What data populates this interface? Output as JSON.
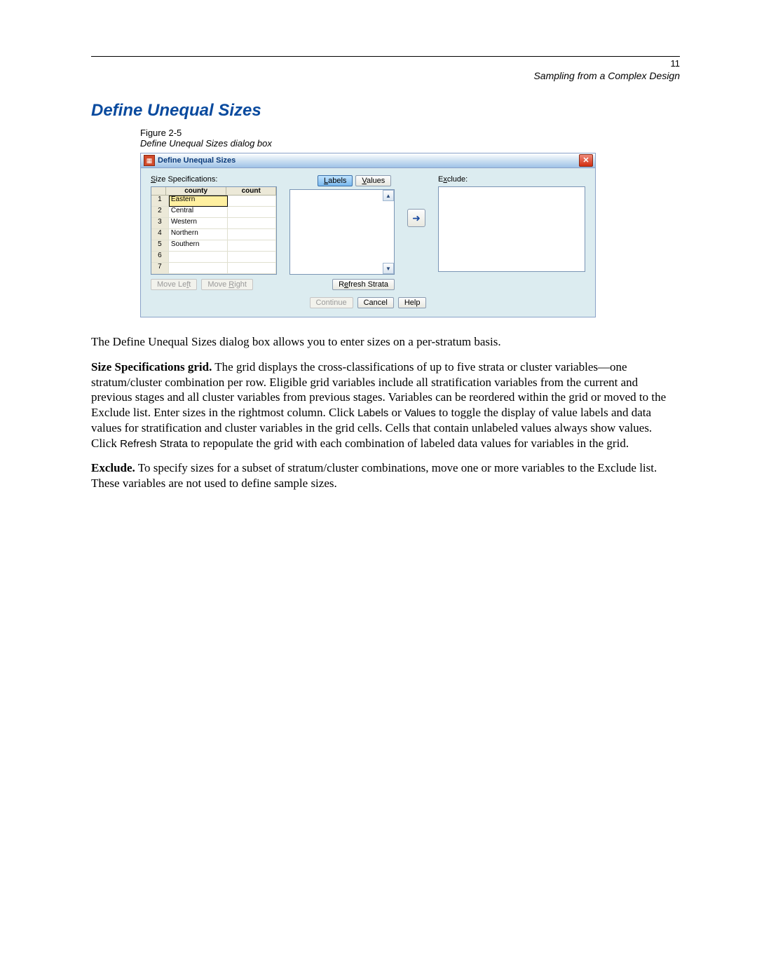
{
  "page": {
    "number": "11",
    "running_head": "Sampling from a Complex Design"
  },
  "section": {
    "title": "Define Unequal Sizes",
    "figure_label": "Figure 2-5",
    "figure_caption": "Define Unequal Sizes dialog box"
  },
  "dialog": {
    "title": "Define Unequal Sizes",
    "size_spec_label": "Size Specifications:",
    "exclude_label": "Exclude:",
    "toggle": {
      "labels": "Labels",
      "values": "Values"
    },
    "grid": {
      "headers": {
        "county": "county",
        "count": "count"
      },
      "rows": [
        {
          "n": "1",
          "county": "Eastern",
          "count": ""
        },
        {
          "n": "2",
          "county": "Central",
          "count": ""
        },
        {
          "n": "3",
          "county": "Western",
          "count": ""
        },
        {
          "n": "4",
          "county": "Northern",
          "count": ""
        },
        {
          "n": "5",
          "county": "Southern",
          "count": ""
        },
        {
          "n": "6",
          "county": "",
          "count": ""
        },
        {
          "n": "7",
          "county": "",
          "count": ""
        }
      ]
    },
    "buttons": {
      "move_left": "Move Left",
      "move_right": "Move Right",
      "refresh": "Refresh Strata",
      "continue": "Continue",
      "cancel": "Cancel",
      "help": "Help"
    }
  },
  "body": {
    "p1": "The Define Unequal Sizes dialog box allows you to enter sizes on a per-stratum basis.",
    "p2_lead": "Size Specifications grid.",
    "p2_a": " The grid displays the cross-classifications of up to five strata or cluster variables—one stratum/cluster combination per row. Eligible grid variables include all stratification variables from the current and previous stages and all cluster variables from previous stages. Variables can be reordered within the grid or moved to the Exclude list. Enter sizes in the rightmost column. Click ",
    "p2_labels": "Labels",
    "p2_or": " or ",
    "p2_values": "Values",
    "p2_b": " to toggle the display of value labels and data values for stratification and cluster variables in the grid cells. Cells that contain unlabeled values always show values. Click ",
    "p2_refresh": "Refresh Strata",
    "p2_c": " to repopulate the grid with each combination of labeled data values for variables in the grid.",
    "p3_lead": "Exclude.",
    "p3": " To specify sizes for a subset of stratum/cluster combinations, move one or more variables to the Exclude list. These variables are not used to define sample sizes."
  }
}
